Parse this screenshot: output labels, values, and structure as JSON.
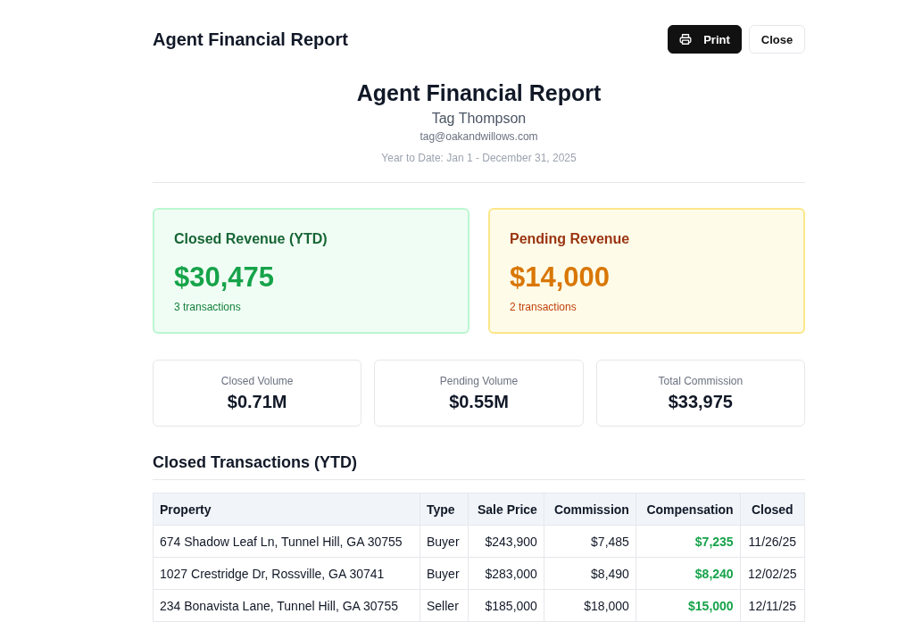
{
  "header": {
    "title": "Agent Financial Report",
    "buttons": [
      {
        "label": "Print",
        "kind": "primary"
      },
      {
        "label": "Close",
        "kind": "secondary"
      }
    ]
  },
  "report": {
    "title": "Agent Financial Report",
    "agent": "Tag Thompson",
    "email": "tag@oakandwillows.com",
    "period": "Year to Date: Jan 1 - December 31, 2025"
  },
  "revenue_cards": [
    {
      "kind": "closed",
      "title": "Closed Revenue (YTD)",
      "amount": "$30,475",
      "count": "3 transactions"
    },
    {
      "kind": "pending",
      "title": "Pending Revenue",
      "amount": "$14,000",
      "count": "2 transactions"
    }
  ],
  "stats": [
    {
      "label": "Closed Volume",
      "value": "$0.71M"
    },
    {
      "label": "Pending Volume",
      "value": "$0.55M"
    },
    {
      "label": "Total Commission",
      "value": "$33,975"
    }
  ],
  "closed_transactions": {
    "title": "Closed Transactions (YTD)",
    "columns": [
      "Property",
      "Type",
      "Sale Price",
      "Commission",
      "Compensation",
      "Closed"
    ],
    "rows": [
      [
        "674 Shadow Leaf Ln, Tunnel Hill, GA 30755",
        "Buyer",
        "$243,900",
        "$7,485",
        "$7,235",
        "11/26/25"
      ],
      [
        "1027 Crestridge Dr, Rossville, GA 30741",
        "Buyer",
        "$283,000",
        "$8,490",
        "$8,240",
        "12/02/25"
      ],
      [
        "234 Bonavista Lane, Tunnel Hill, GA 30755",
        "Seller",
        "$185,000",
        "$18,000",
        "$15,000",
        "12/11/25"
      ]
    ]
  }
}
